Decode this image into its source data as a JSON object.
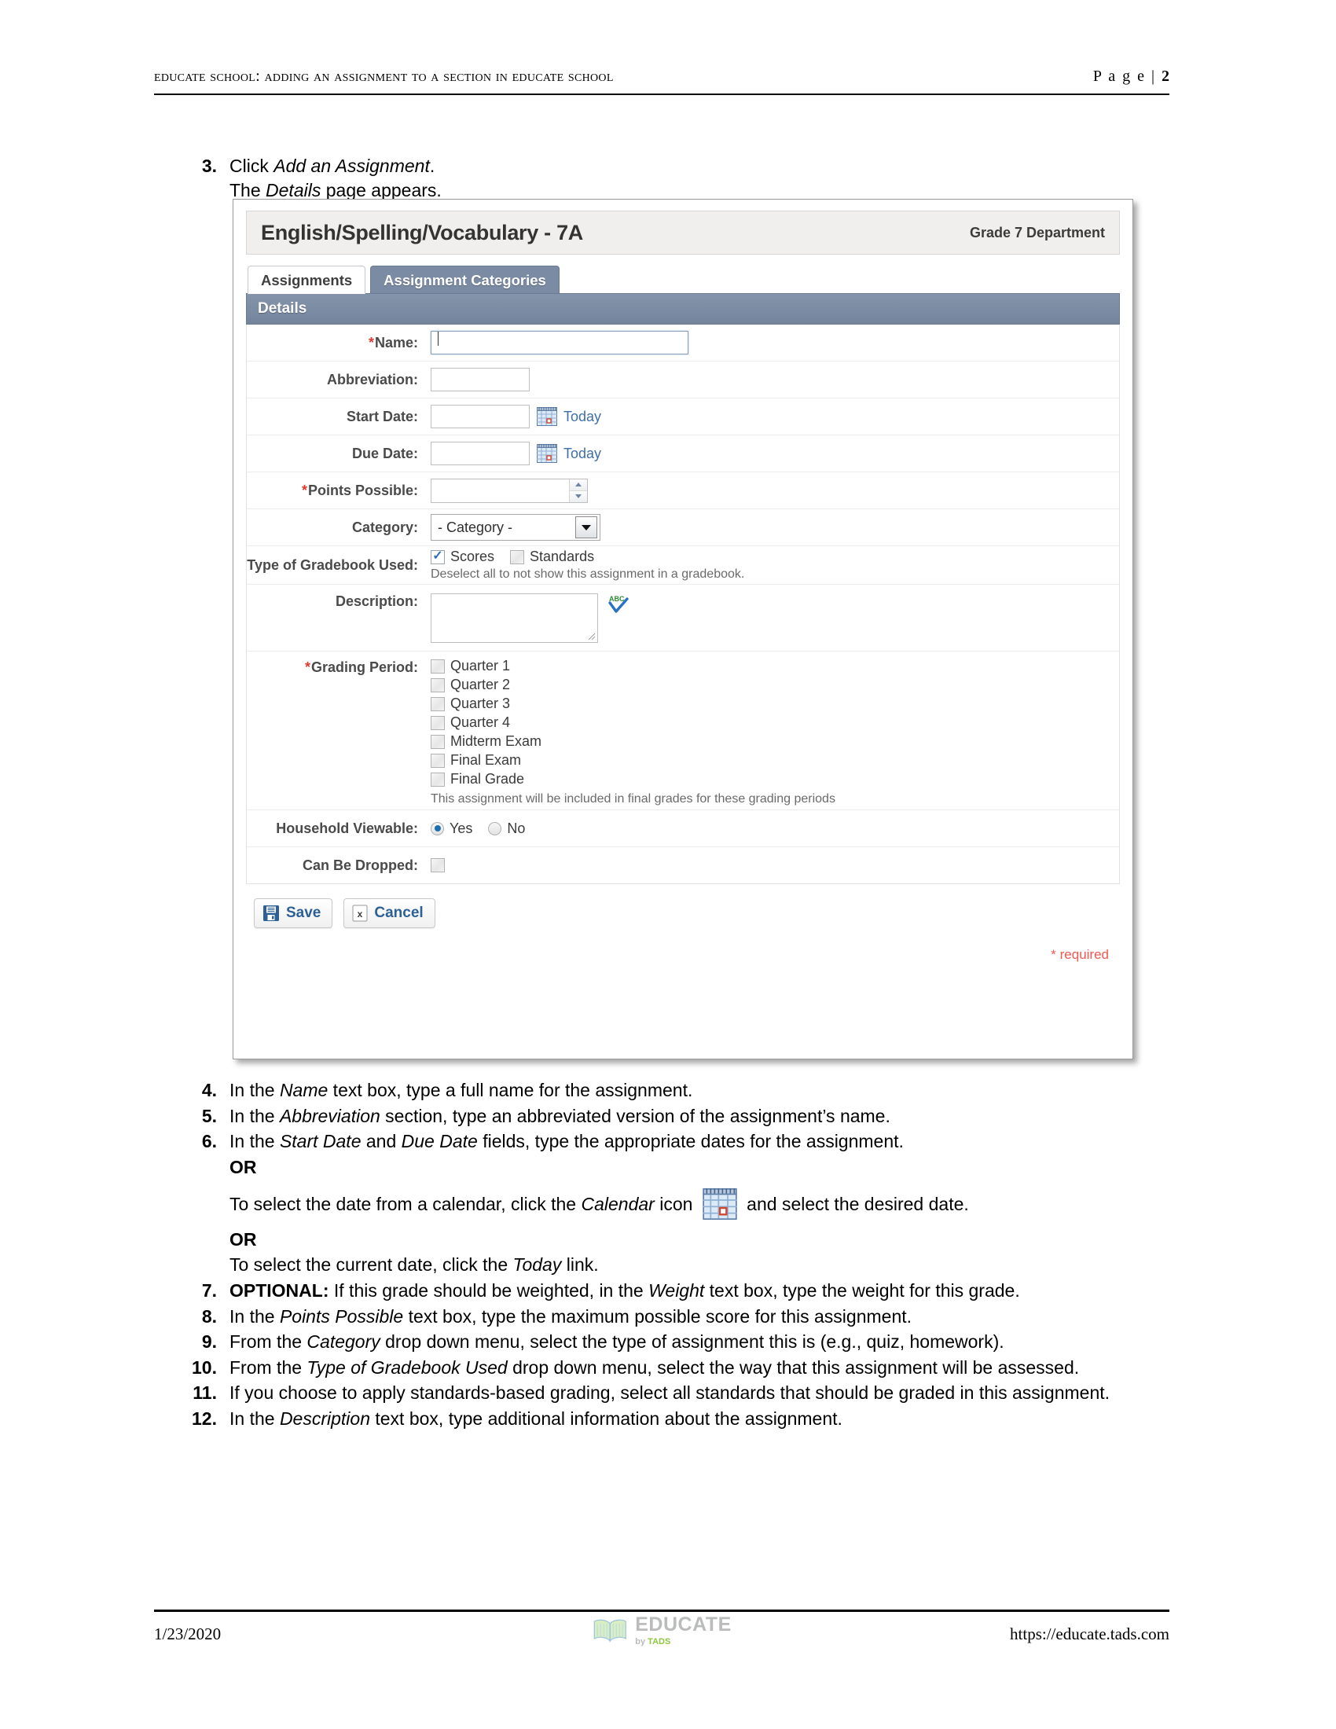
{
  "header": {
    "title": "Educate School: Adding an Assignment to a Section in Educate School",
    "page_prefix": "P a g e  | ",
    "page_number": "2"
  },
  "intro_steps": [
    {
      "num": "3.",
      "text_parts": [
        "Click ",
        "Add an Assignment",
        "."
      ]
    },
    {
      "num": "",
      "text_parts": [
        "The ",
        "Details",
        " page appears."
      ]
    }
  ],
  "step3": {
    "num": "3.",
    "line1_pre": "Click ",
    "line1_em": "Add an Assignment",
    "line1_post": ".",
    "line2_pre": "The ",
    "line2_em": "Details",
    "line2_post": " page appears."
  },
  "screenshot": {
    "title": "English/Spelling/Vocabulary - 7A",
    "department": "Grade 7 Department",
    "tabs": [
      {
        "label": "Assignments",
        "active": true
      },
      {
        "label": "Assignment Categories",
        "active": false
      }
    ],
    "section_header": "Details",
    "fields": {
      "name": {
        "label": "Name:",
        "required": true,
        "value": "",
        "placeholder": ""
      },
      "abbreviation": {
        "label": "Abbreviation:",
        "required": false,
        "value": "",
        "placeholder": ""
      },
      "start_date": {
        "label": "Start Date:",
        "required": false,
        "value": "",
        "today_link": "Today",
        "calendar_icon": "calendar-icon"
      },
      "due_date": {
        "label": "Due Date:",
        "required": false,
        "value": "",
        "today_link": "Today",
        "calendar_icon": "calendar-icon"
      },
      "points_possible": {
        "label": "Points Possible:",
        "required": true,
        "value": ""
      },
      "category": {
        "label": "Category:",
        "required": false,
        "selected": "- Category -"
      },
      "gradebook": {
        "label": "Type of Gradebook Used:",
        "options": [
          {
            "label": "Scores",
            "checked": true
          },
          {
            "label": "Standards",
            "checked": false
          }
        ],
        "helper": "Deselect all to not show this assignment in a gradebook."
      },
      "description": {
        "label": "Description:",
        "value": "",
        "spellcheck_icon": "spellcheck-abc-icon"
      },
      "grading_period": {
        "label": "Grading Period:",
        "required": true,
        "options": [
          {
            "label": "Quarter 1",
            "checked": false
          },
          {
            "label": "Quarter 2",
            "checked": false
          },
          {
            "label": "Quarter 3",
            "checked": false
          },
          {
            "label": "Quarter 4",
            "checked": false
          },
          {
            "label": "Midterm Exam",
            "checked": false
          },
          {
            "label": "Final Exam",
            "checked": false
          },
          {
            "label": "Final Grade",
            "checked": false
          }
        ],
        "helper": "This assignment will be included in final grades for these grading periods"
      },
      "household_viewable": {
        "label": "Household Viewable:",
        "options": [
          {
            "label": "Yes",
            "selected": true
          },
          {
            "label": "No",
            "selected": false
          }
        ]
      },
      "can_be_dropped": {
        "label": "Can Be Dropped:",
        "checked": false
      }
    },
    "buttons": {
      "save": "Save",
      "cancel": "Cancel"
    },
    "required_note": "required",
    "required_star": "*",
    "colors": {
      "tab_inactive_bg": "#7b8ba3",
      "details_bar_bg": "#7b8ba3",
      "link_blue": "#3f6fa8",
      "required_red": "#e03b2f",
      "button_text_blue": "#2d6094"
    }
  },
  "steps": [
    {
      "num": "4.",
      "pre": "In the ",
      "em": "Name",
      "post": " text box, type a full name for the assignment."
    },
    {
      "num": "5.",
      "pre": "In the ",
      "em": "Abbreviation",
      "post": " section, type an abbreviated version of the assignment’s name."
    }
  ],
  "step6": {
    "num": "6.",
    "pre": "In the ",
    "em1": "Start Date",
    "mid": " and ",
    "em2": "Due Date",
    "post": " fields, type the appropriate dates for the assignment.",
    "or1": "OR",
    "calendar_line_pre": "To select the date from a calendar, click the ",
    "calendar_line_em": "Calendar",
    "calendar_line_mid": " icon ",
    "calendar_line_post": " and select the desired date.",
    "or2": "OR",
    "today_line_pre": "To select the current date, click the ",
    "today_line_em": "Today",
    "today_line_post": " link."
  },
  "step7": {
    "num": "7.",
    "bold": "OPTIONAL:",
    "pre": " If this grade should be weighted, in the ",
    "em": "Weight",
    "post": " text box, type the weight for this grade."
  },
  "steps_rest": [
    {
      "num": "8.",
      "pre": "In the ",
      "em": "Points Possible",
      "post": " text box, type the maximum possible score for this assignment."
    },
    {
      "num": "9.",
      "pre": "From the ",
      "em": "Category",
      "post": " drop down menu, select the type of assignment this is (e.g., quiz, homework)."
    },
    {
      "num": "10.",
      "pre": "From the ",
      "em": "Type of Gradebook Used",
      "post": " drop down menu, select the way that this assignment will be assessed."
    },
    {
      "num": "11.",
      "pre": "If you choose to apply standards-based grading, select all standards that should be graded in this assignment.",
      "em": "",
      "post": ""
    },
    {
      "num": "12.",
      "pre": "In the ",
      "em": "Description",
      "post": " text box, type additional information about the assignment."
    }
  ],
  "footer": {
    "date": "1/23/2020",
    "url": "https://educate.tads.com",
    "logo_main": "EDUCATE",
    "logo_by": "by ",
    "logo_brand": "TADS"
  }
}
